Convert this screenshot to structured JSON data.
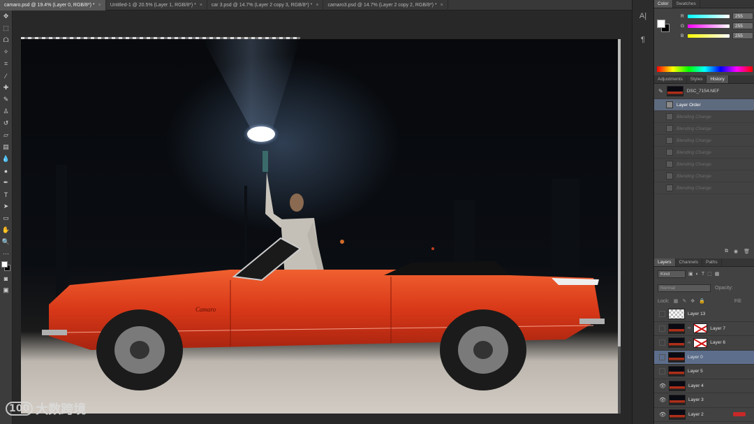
{
  "tabs": [
    {
      "label": "camaro.psd @ 19.4% (Layer 0, RGB/8*) *",
      "active": true
    },
    {
      "label": "Untitled-1 @ 20.5% (Layer 1, RGB/8*) *",
      "active": false
    },
    {
      "label": "car 3.psd @ 14.7% (Layer 2 copy 3, RGB/8*) *",
      "active": false
    },
    {
      "label": "camaro3.psd @ 14.7% (Layer 2 copy 2, RGB/8*) *",
      "active": false
    }
  ],
  "tab_close": "×",
  "color_panel": {
    "tabs": [
      "Color",
      "Swatches"
    ],
    "r_label": "R",
    "g_label": "G",
    "b_label": "B",
    "r": "255",
    "g": "255",
    "b": "255"
  },
  "history_panel": {
    "tabs": [
      "Adjustments",
      "Styles",
      "History"
    ],
    "snapshot": "DSC_7154.NEF",
    "states": [
      {
        "label": "Layer Order",
        "state": "selected"
      },
      {
        "label": "Blending Change",
        "state": "dim"
      },
      {
        "label": "Blending Change",
        "state": "dim"
      },
      {
        "label": "Blending Change",
        "state": "dim"
      },
      {
        "label": "Blending Change",
        "state": "dim"
      },
      {
        "label": "Blending Change",
        "state": "dim"
      },
      {
        "label": "Blending Change",
        "state": "dim"
      },
      {
        "label": "Blending Change",
        "state": "dim"
      }
    ]
  },
  "layers_panel": {
    "tabs": [
      "Layers",
      "Channels",
      "Paths"
    ],
    "kind": "Kind",
    "blend_mode": "Normal",
    "opacity_label": "Opacity:",
    "lock_label": "Lock:",
    "fill_label": "Fill:",
    "layers": [
      {
        "name": "Layer 13",
        "visible": false,
        "mask": false,
        "selected": false
      },
      {
        "name": "Layer 7",
        "visible": false,
        "mask": true,
        "selected": false
      },
      {
        "name": "Layer 6",
        "visible": false,
        "mask": true,
        "selected": false
      },
      {
        "name": "Layer 0",
        "visible": false,
        "mask": false,
        "selected": true
      },
      {
        "name": "Layer 5",
        "visible": false,
        "mask": false,
        "selected": false
      },
      {
        "name": "Layer 4",
        "visible": true,
        "mask": false,
        "selected": false
      },
      {
        "name": "Layer 3",
        "visible": true,
        "mask": false,
        "selected": false
      },
      {
        "name": "Layer 2",
        "visible": true,
        "mask": false,
        "selected": false
      }
    ]
  },
  "car_badge": "Camaro",
  "watermark": {
    "logo": "100",
    "text": "大数跨境"
  },
  "colors": {
    "accent": "#5d6e8c",
    "car": "#c8381c",
    "bg": "#282828"
  }
}
